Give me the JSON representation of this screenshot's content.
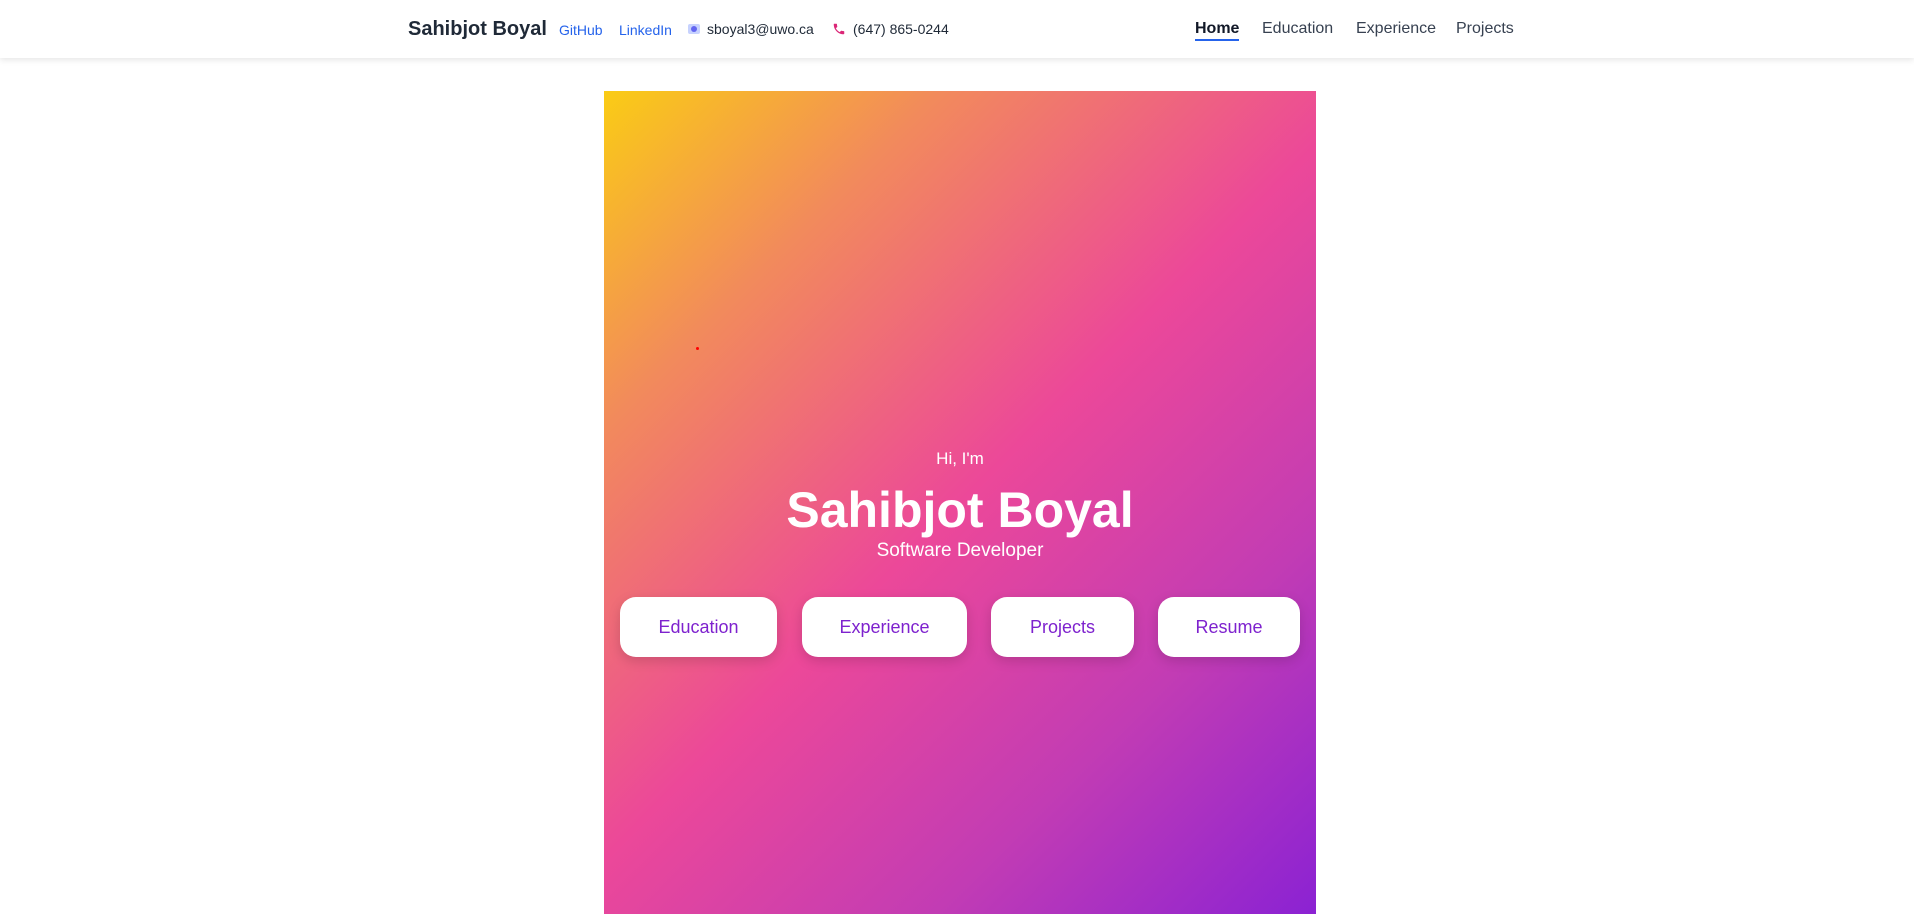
{
  "header": {
    "brand": "Sahibjot Boyal",
    "github_label": "GitHub",
    "linkedin_label": "LinkedIn",
    "email": "sboyal3@uwo.ca",
    "phone": "(647) 865-0244",
    "email_icon": "email-icon",
    "phone_icon": "phone-icon",
    "link_color": "#2563eb"
  },
  "nav": {
    "items": [
      {
        "label": "Home",
        "active": true
      },
      {
        "label": "Education",
        "active": false
      },
      {
        "label": "Experience",
        "active": false
      },
      {
        "label": "Projects",
        "active": false
      }
    ]
  },
  "hero": {
    "greeting": "Hi, I'm",
    "name": "Sahibjot Boyal",
    "role": "Software Developer",
    "buttons": [
      "Education",
      "Experience",
      "Projects",
      "Resume"
    ],
    "gradient_colors": [
      "#facc15",
      "#ec4899",
      "#8b22d3"
    ],
    "button_text_color": "#7e22ce"
  }
}
